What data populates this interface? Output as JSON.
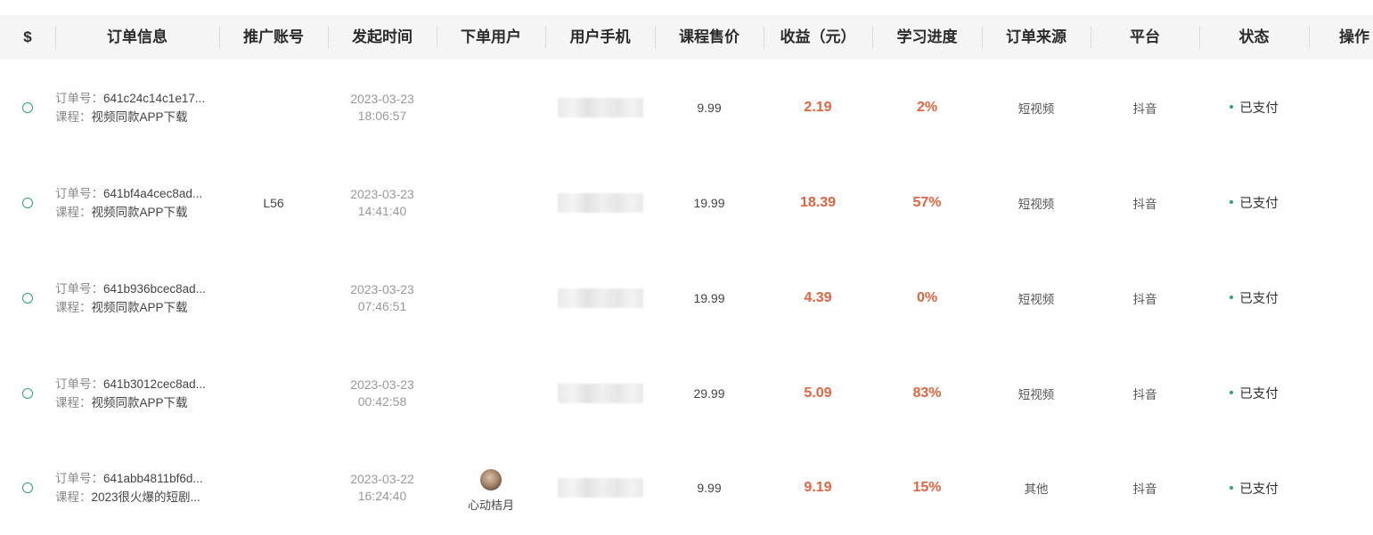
{
  "columns": {
    "select": "$",
    "order_info": "订单信息",
    "promoter": "推广账号",
    "created": "发起时间",
    "buyer": "下单用户",
    "phone": "用户手机",
    "price": "课程售价",
    "income": "收益（元）",
    "progress": "学习进度",
    "source": "订单来源",
    "platform": "平台",
    "status": "状态",
    "actions": "操作"
  },
  "labels": {
    "order_no": "订单号：",
    "course": "课程："
  },
  "colors": {
    "accent_green": "#2aa575",
    "highlight_red": "#e2643f",
    "header_bg": "#f5f5f5"
  },
  "rows": [
    {
      "order_no": "641c24c14c1e17...",
      "course": "视频同款APP下载",
      "promoter": "",
      "date": "2023-03-23",
      "time": "18:06:57",
      "buyer": "",
      "price": "9.99",
      "income": "2.19",
      "progress": "2%",
      "source": "短视频",
      "platform": "抖音",
      "status": "已支付"
    },
    {
      "order_no": "641bf4a4cec8ad...",
      "course": "视频同款APP下载",
      "promoter": "L56",
      "date": "2023-03-23",
      "time": "14:41:40",
      "buyer": "",
      "price": "19.99",
      "income": "18.39",
      "progress": "57%",
      "source": "短视频",
      "platform": "抖音",
      "status": "已支付"
    },
    {
      "order_no": "641b936bcec8ad...",
      "course": "视频同款APP下载",
      "promoter": "",
      "date": "2023-03-23",
      "time": "07:46:51",
      "buyer": "",
      "price": "19.99",
      "income": "4.39",
      "progress": "0%",
      "source": "短视频",
      "platform": "抖音",
      "status": "已支付"
    },
    {
      "order_no": "641b3012cec8ad...",
      "course": "视频同款APP下载",
      "promoter": "",
      "date": "2023-03-23",
      "time": "00:42:58",
      "buyer": "",
      "price": "29.99",
      "income": "5.09",
      "progress": "83%",
      "source": "短视频",
      "platform": "抖音",
      "status": "已支付"
    },
    {
      "order_no": "641abb4811bf6d...",
      "course": "2023很火爆的短剧...",
      "promoter": "",
      "date": "2023-03-22",
      "time": "16:24:40",
      "buyer": "心动桔月",
      "price": "9.99",
      "income": "9.19",
      "progress": "15%",
      "source": "其他",
      "platform": "抖音",
      "status": "已支付"
    }
  ]
}
